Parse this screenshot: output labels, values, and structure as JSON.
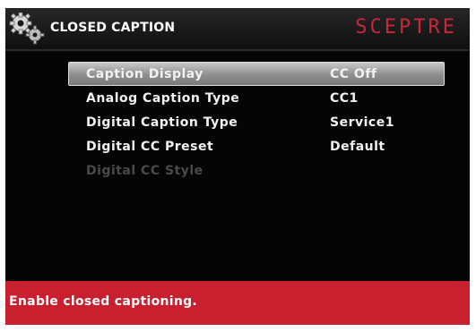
{
  "header": {
    "title": "CLOSED CAPTION",
    "brand": "SCEPTRE",
    "icon": "gears-icon"
  },
  "menu": {
    "items": [
      {
        "label": "Caption Display",
        "value": "CC Off",
        "state": "selected"
      },
      {
        "label": "Analog Caption Type",
        "value": "CC1",
        "state": "normal"
      },
      {
        "label": "Digital Caption Type",
        "value": "Service1",
        "state": "normal"
      },
      {
        "label": "Digital CC Preset",
        "value": "Default",
        "state": "normal"
      },
      {
        "label": "Digital CC Style",
        "value": "",
        "state": "disabled"
      }
    ]
  },
  "footer": {
    "help_text": "Enable closed captioning."
  },
  "colors": {
    "brand": "#c8283a",
    "footer_bg": "#c8202e",
    "screen_bg": "#050505",
    "selected_bar": "#9a9a9a",
    "disabled_text": "#4a4a4a"
  }
}
